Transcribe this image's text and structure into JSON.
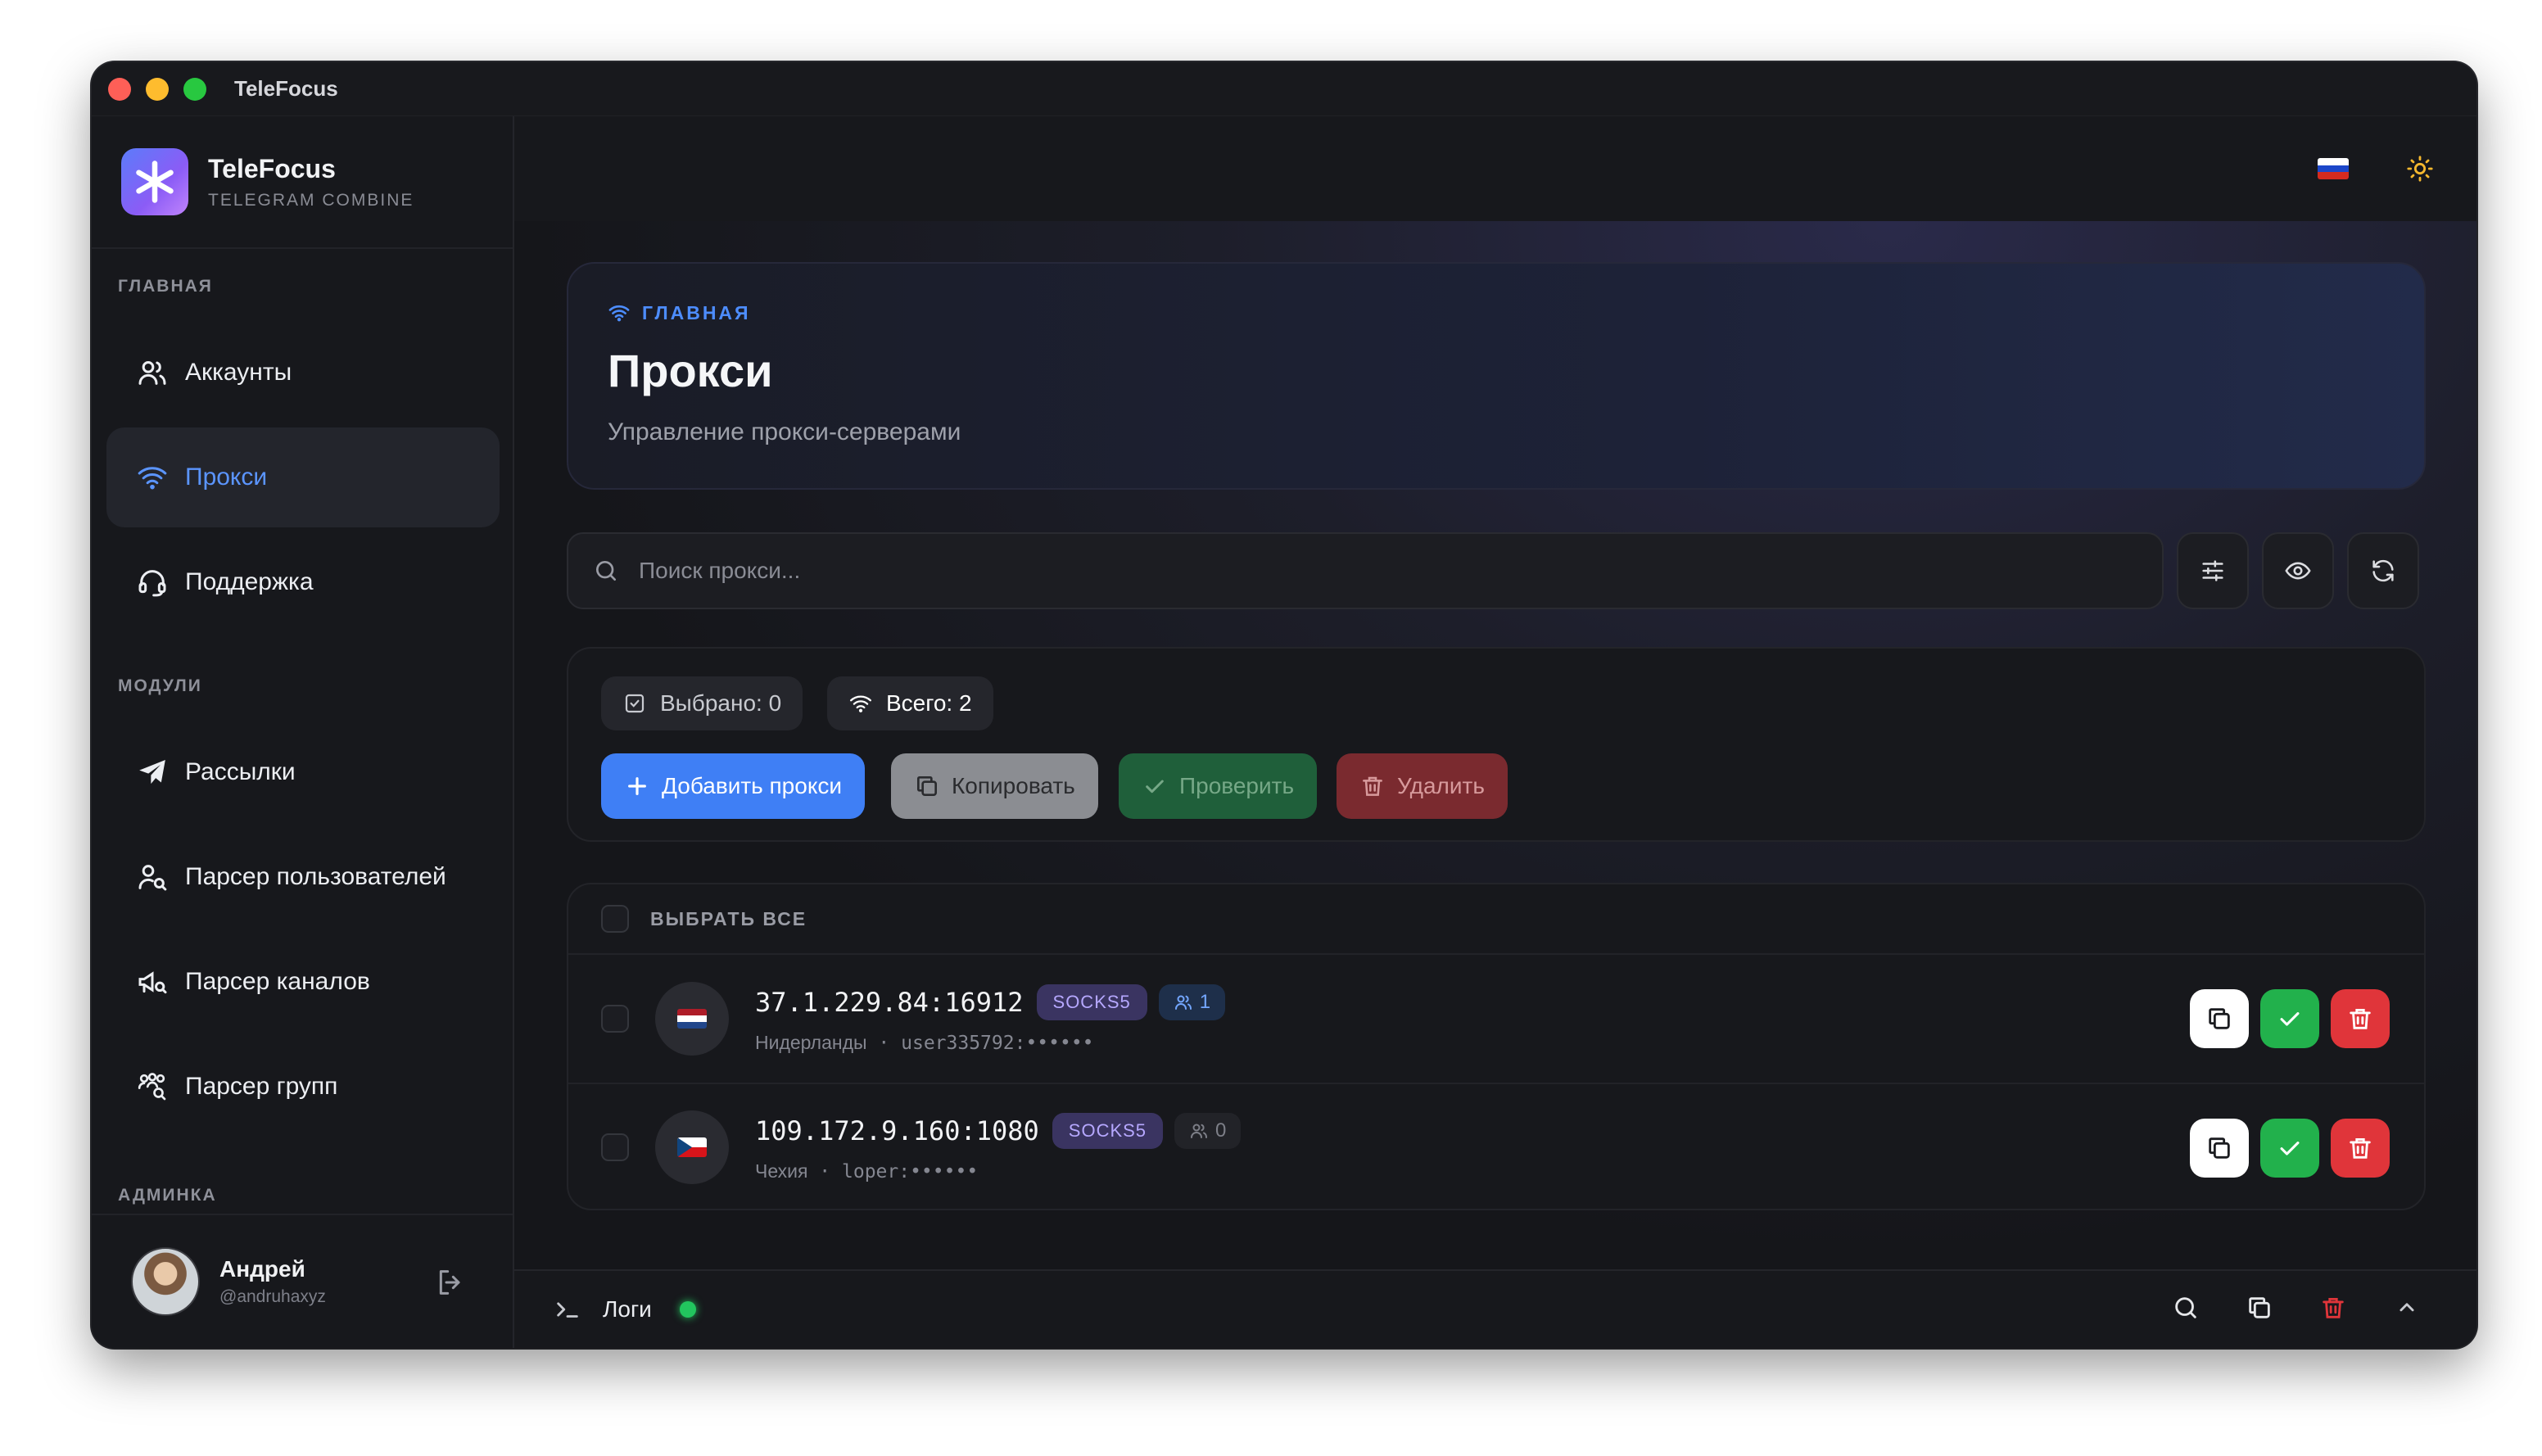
{
  "window": {
    "title": "TeleFocus"
  },
  "brand": {
    "name": "TeleFocus",
    "subtitle": "TELEGRAM COMBINE"
  },
  "sidebar": {
    "section_main": "ГЛАВНАЯ",
    "main_items": [
      {
        "label": "Аккаунты",
        "icon": "users-icon"
      },
      {
        "label": "Прокси",
        "icon": "wifi-icon",
        "active": true
      },
      {
        "label": "Поддержка",
        "icon": "headset-icon"
      }
    ],
    "section_modules": "МОДУЛИ",
    "module_items": [
      {
        "label": "Рассылки",
        "icon": "send-icon"
      },
      {
        "label": "Парсер пользователей",
        "icon": "user-search-icon"
      },
      {
        "label": "Парсер каналов",
        "icon": "megaphone-search-icon"
      },
      {
        "label": "Парсер групп",
        "icon": "group-search-icon"
      }
    ],
    "section_admin": "АДМИНКА"
  },
  "user": {
    "name": "Андрей",
    "handle": "@andruhaxyz"
  },
  "header": {
    "breadcrumb": "ГЛАВНАЯ",
    "title": "Прокси",
    "subtitle": "Управление прокси-серверами"
  },
  "search": {
    "placeholder": "Поиск прокси..."
  },
  "stats": {
    "selected": "Выбрано: 0",
    "total": "Всего: 2"
  },
  "actions": {
    "add": "Добавить прокси",
    "copy": "Копировать",
    "check": "Проверить",
    "delete": "Удалить"
  },
  "list": {
    "select_all": "ВЫБРАТЬ ВСЕ",
    "rows": [
      {
        "address": "37.1.229.84:16912",
        "type": "SOCKS5",
        "count": "1",
        "country": "Нидерланды",
        "sep": "·",
        "auth": "user335792:••••••"
      },
      {
        "address": "109.172.9.160:1080",
        "type": "SOCKS5",
        "count": "0",
        "country": "Чехия",
        "sep": "·",
        "auth": "loper:••••••"
      }
    ]
  },
  "logs": {
    "label": "Логи"
  },
  "colors": {
    "accent": "#4d8dff",
    "success": "#22b14c",
    "danger": "#e0353a",
    "type_badge": "#b6a8ff"
  }
}
